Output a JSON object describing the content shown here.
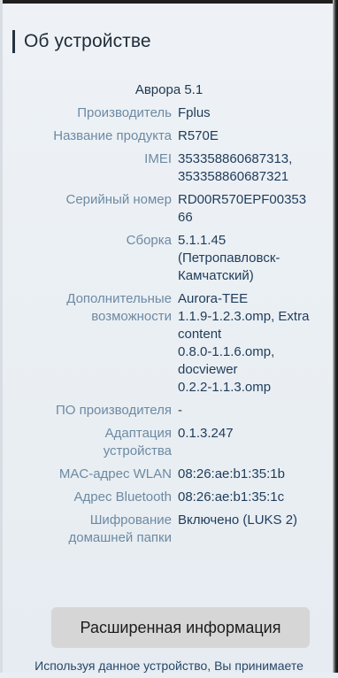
{
  "header": {
    "title": "Об устройстве"
  },
  "os_version": "Аврора 5.1",
  "info": [
    {
      "label": "Производитель",
      "value": "Fplus"
    },
    {
      "label": "Название продукта",
      "value": "R570E"
    },
    {
      "label": "IMEI",
      "value": "353358860687313,\n353358860687321"
    },
    {
      "label": "Серийный номер",
      "value": "RD00R570EPF00353\n66"
    },
    {
      "label": "Сборка",
      "value": "5.1.1.45\n(Петропавловск-\nКамчатский)"
    },
    {
      "label": "Дополнительные\nвозможности",
      "value": "Aurora-TEE\n1.1.9-1.2.3.omp, Extra\ncontent\n0.8.0-1.1.6.omp,\ndocviewer\n0.2.2-1.1.3.omp"
    },
    {
      "label": "ПО производителя",
      "value": "-"
    },
    {
      "label": "Адаптация\nустройства",
      "value": "0.1.3.247"
    },
    {
      "label": "MAC-адрес WLAN",
      "value": "08:26:ae:b1:35:1b"
    },
    {
      "label": "Адрес Bluetooth",
      "value": "08:26:ae:b1:35:1c"
    },
    {
      "label": "Шифрование\nдомашней папки",
      "value": "Включено (LUKS 2)"
    }
  ],
  "advanced_button_label": "Расширенная информация",
  "footer_text": "Используя данное устройство, Вы принимаете"
}
